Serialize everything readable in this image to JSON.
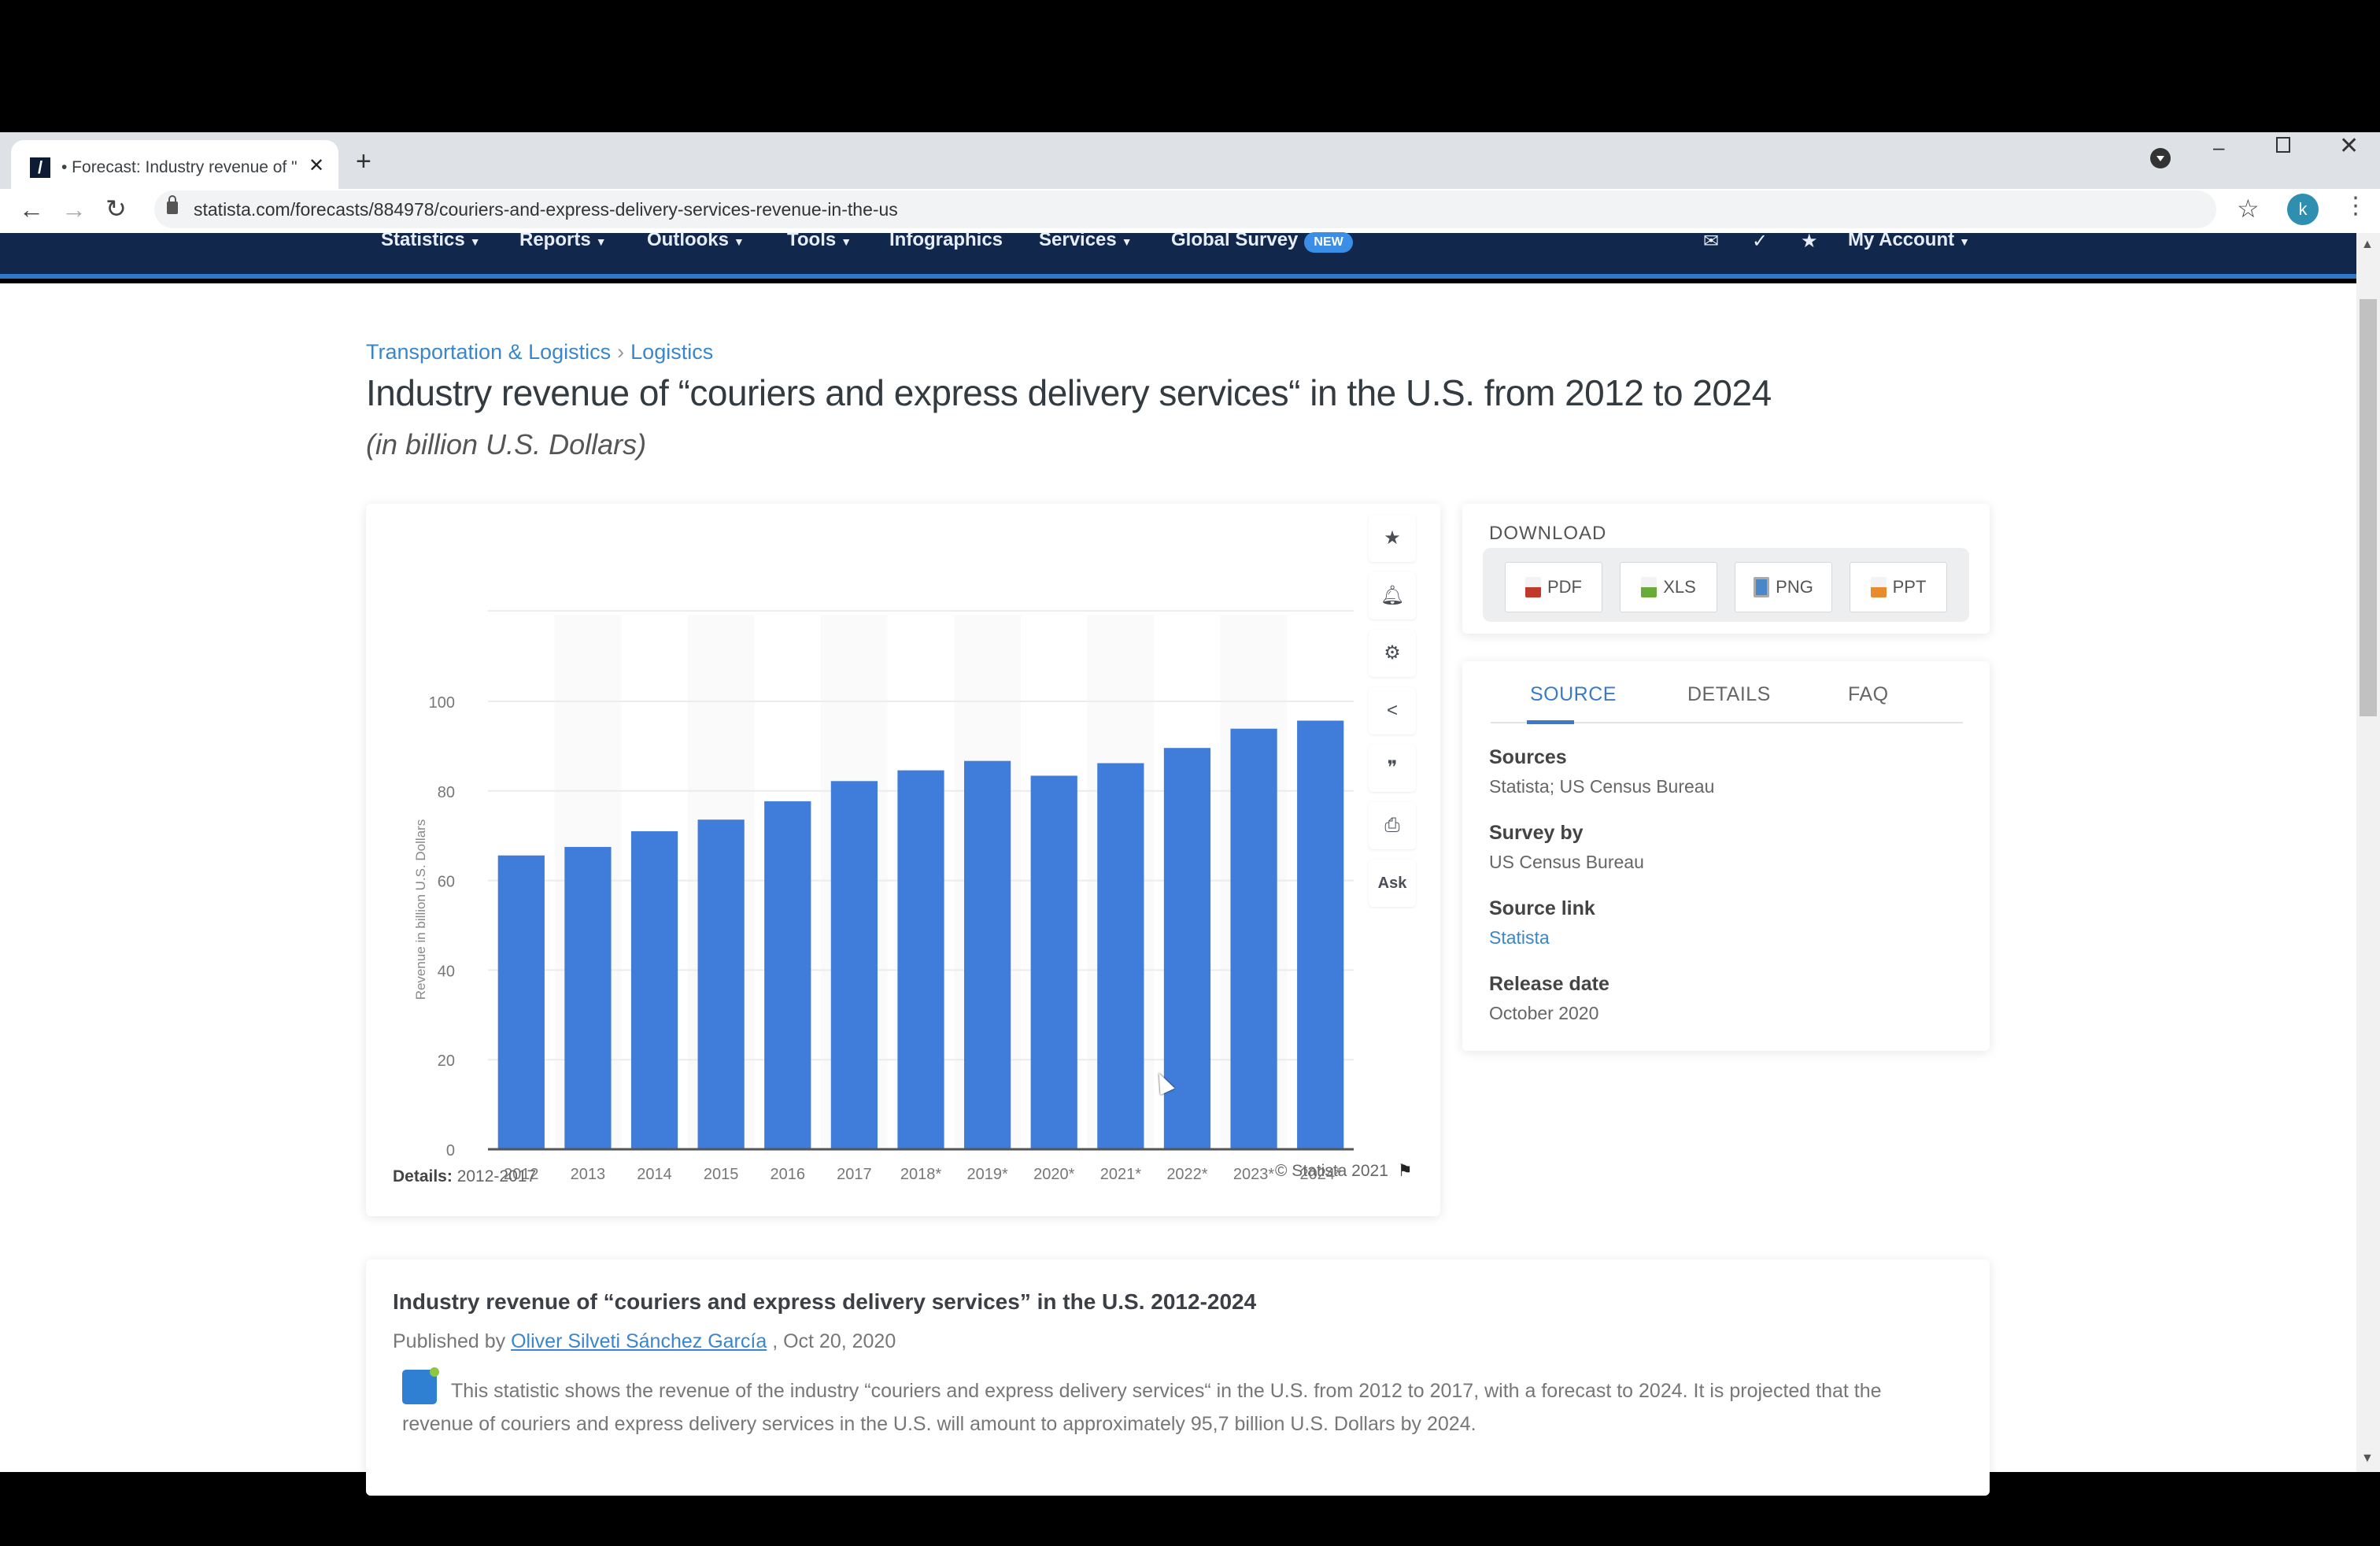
{
  "browser": {
    "tab_title": "• Forecast: Industry revenue of \"c",
    "tab_close": "✕",
    "new_tab": "+",
    "url": "statista.com/forecasts/884978/couriers-and-express-delivery-services-revenue-in-the-us",
    "profile_initial": "k",
    "icons": {
      "back": "←",
      "forward": "→",
      "reload": "↻",
      "bookmark": "☆",
      "menu": "⋮",
      "minimize": "–",
      "close": "✕"
    }
  },
  "nav": {
    "items": [
      {
        "label": "Statistics",
        "dropdown": true
      },
      {
        "label": "Reports",
        "dropdown": true
      },
      {
        "label": "Outlooks",
        "dropdown": true
      },
      {
        "label": "Tools",
        "dropdown": true
      },
      {
        "label": "Infographics",
        "dropdown": false
      },
      {
        "label": "Services",
        "dropdown": true
      },
      {
        "label": "Global Survey",
        "dropdown": false
      }
    ],
    "new_badge": "NEW",
    "caret": "▼",
    "account_label": "My Account",
    "icons": {
      "mail": "✉",
      "check": "✓",
      "star": "★"
    }
  },
  "breadcrumb": {
    "items": [
      "Transportation & Logistics",
      "Logistics"
    ],
    "separator": "›"
  },
  "page": {
    "title": "Industry revenue of “couriers and express delivery services“ in the U.S. from 2012 to 2024",
    "subtitle": "(in billion U.S. Dollars)"
  },
  "chart_tools": [
    {
      "name": "favorite",
      "glyph": "★"
    },
    {
      "name": "notification",
      "glyph": "🔔︎"
    },
    {
      "name": "settings",
      "glyph": "⚙"
    },
    {
      "name": "share",
      "glyph": "<"
    },
    {
      "name": "cite",
      "glyph": "❞"
    },
    {
      "name": "print",
      "glyph": "⎙"
    },
    {
      "name": "ask",
      "glyph": "Ask"
    }
  ],
  "chart_footer": {
    "details_label": "Details:",
    "details_value": "2012-2017",
    "copyright": "© Statista 2021",
    "flag": "⚑"
  },
  "chart_data": {
    "type": "bar",
    "title": "Industry revenue of “couriers and express delivery services“ in the U.S. from 2012 to 2024",
    "xlabel": "",
    "ylabel": "Revenue in billion U.S. Dollars",
    "categories": [
      "2012",
      "2013",
      "2014",
      "2015",
      "2016",
      "2017",
      "2018*",
      "2019*",
      "2020*",
      "2021*",
      "2022*",
      "2023*",
      "2024*"
    ],
    "values": [
      65.6,
      67.5,
      71.0,
      73.6,
      77.7,
      82.2,
      84.6,
      86.7,
      83.4,
      86.2,
      89.6,
      93.9,
      95.7
    ],
    "yticks": [
      0,
      20,
      40,
      60,
      80,
      100
    ],
    "ylim": [
      0,
      100
    ],
    "grid": true,
    "legend": "none",
    "bar_color": "#407ddb"
  },
  "download": {
    "label": "DOWNLOAD",
    "buttons": [
      {
        "label": "PDF",
        "color": "#c0392b"
      },
      {
        "label": "XLS",
        "color": "#6aaa3a"
      },
      {
        "label": "PNG",
        "color": "#4a86c8"
      },
      {
        "label": "PPT",
        "color": "#e88a2e"
      }
    ]
  },
  "source_panel": {
    "tabs": [
      "SOURCE",
      "DETAILS",
      "FAQ"
    ],
    "active_tab": "SOURCE",
    "fields": [
      {
        "label": "Sources",
        "value": "Statista; US Census Bureau",
        "link": false
      },
      {
        "label": "Survey by",
        "value": "US Census Bureau",
        "link": false
      },
      {
        "label": "Source link",
        "value": "Statista",
        "link": true
      },
      {
        "label": "Release date",
        "value": "October 2020",
        "link": false
      }
    ]
  },
  "description": {
    "title": "Industry revenue of “couriers and express delivery services” in the U.S. 2012-2024",
    "published_prefix": "Published by",
    "author": "Oliver Silveti Sánchez García",
    "published_suffix": ", Oct 20, 2020",
    "text": "This statistic shows the revenue of the industry “couriers and express delivery services“ in the U.S. from 2012 to 2017, with a forecast to 2024. It is projected that the revenue of couriers and express delivery services in the U.S. will amount to approximately 95,7 billion U.S. Dollars by 2024."
  }
}
